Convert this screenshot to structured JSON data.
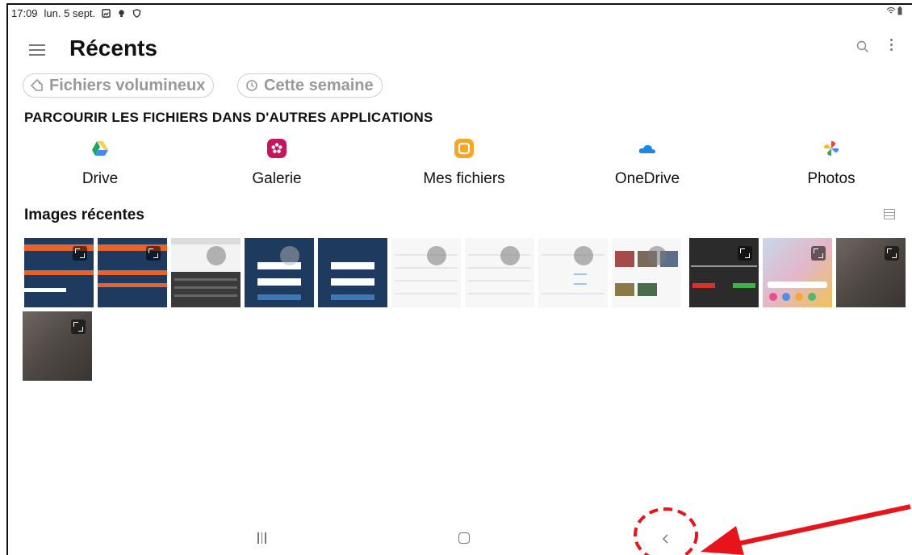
{
  "status_bar": {
    "time": "17:09",
    "date": "lun. 5 sept.",
    "icons": [
      "gallery-icon",
      "bulb-icon",
      "shield-icon"
    ],
    "right_icons": [
      "wifi-icon",
      "battery-icon"
    ]
  },
  "header": {
    "title": "Récents",
    "icons": [
      "menu-icon",
      "search-icon",
      "more-options-icon"
    ]
  },
  "chips": [
    {
      "label": "Fichiers volumineux",
      "icon": "tag-icon"
    },
    {
      "label": "Cette semaine",
      "icon": "history-icon"
    }
  ],
  "browse": {
    "title": "PARCOURIR LES FICHIERS DANS D'AUTRES APPLICATIONS",
    "apps": [
      {
        "label": "Drive",
        "icon": "drive-icon"
      },
      {
        "label": "Galerie",
        "icon": "gallery-app-icon"
      },
      {
        "label": "Mes fichiers",
        "icon": "my-files-icon"
      },
      {
        "label": "OneDrive",
        "icon": "onedrive-icon"
      },
      {
        "label": "Photos",
        "icon": "photos-icon"
      }
    ]
  },
  "recent_images": {
    "title": "Images récentes",
    "view_icon": "list-view-icon",
    "count": 13
  },
  "nav_bar": {
    "icons": [
      "recent-apps-icon",
      "home-icon",
      "back-icon"
    ]
  },
  "colors": {
    "annotation": "#e8141b",
    "drive_green": "#1fa463",
    "drive_yellow": "#ffd04b",
    "drive_blue": "#4688f4",
    "gallery_pink": "#c2185b",
    "files_orange": "#f5a623",
    "onedrive_blue": "#1e88e5"
  }
}
